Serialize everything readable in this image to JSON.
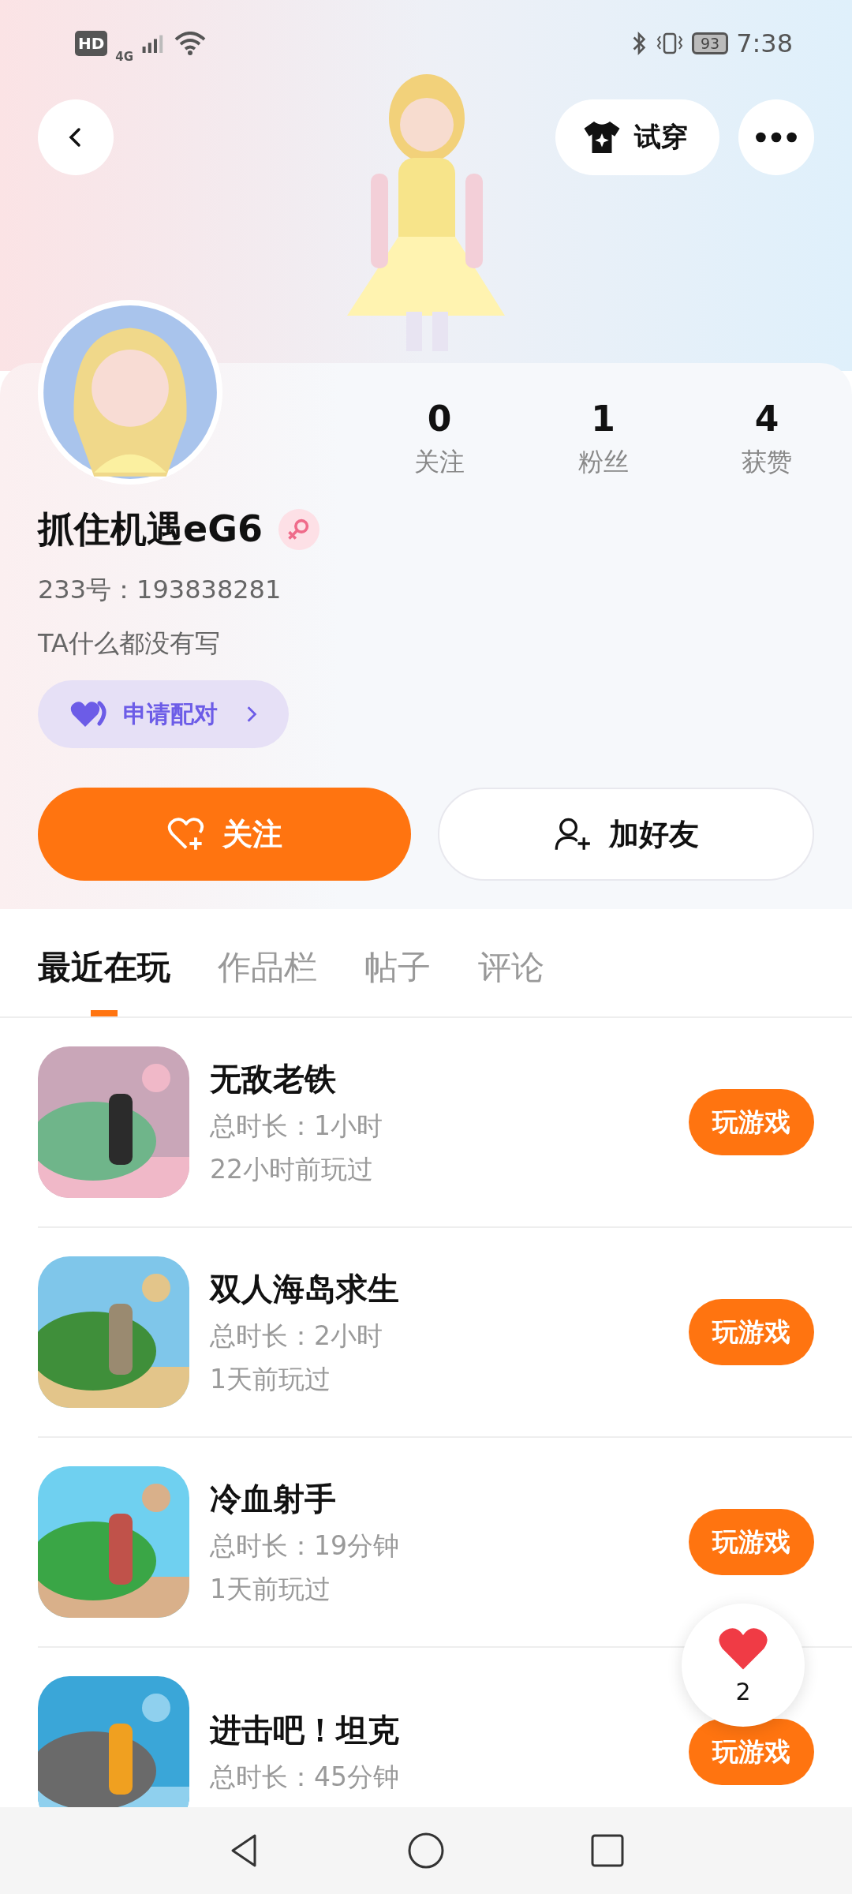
{
  "status_bar": {
    "hd": "HD",
    "network": "4G",
    "battery": "93",
    "time": "7:38"
  },
  "header": {
    "try_on": "试穿"
  },
  "profile": {
    "stats": [
      {
        "value": "0",
        "label": "关注"
      },
      {
        "value": "1",
        "label": "粉丝"
      },
      {
        "value": "4",
        "label": "获赞"
      }
    ],
    "name": "抓住机遇eG6",
    "id_line": "233号：193838281",
    "bio": "TA什么都没有写",
    "match_button": "申请配对"
  },
  "actions": {
    "follow": "关注",
    "add_friend": "加好友"
  },
  "tabs": [
    {
      "label": "最近在玩",
      "selected": true
    },
    {
      "label": "作品栏",
      "selected": false
    },
    {
      "label": "帖子",
      "selected": false
    },
    {
      "label": "评论",
      "selected": false
    }
  ],
  "games": [
    {
      "title": "无敌老铁",
      "duration": "总时长：1小时",
      "last_played": "22小时前玩过",
      "button": "玩游戏",
      "kind": "picture"
    },
    {
      "title": "双人海岛求生",
      "duration": "总时长：2小时",
      "last_played": "1天前玩过",
      "button": "玩游戏",
      "kind": "picture"
    },
    {
      "title": "冷血射手",
      "duration": "总时长：19分钟",
      "last_played": "1天前玩过",
      "button": "玩游戏",
      "kind": "picture"
    },
    {
      "title": "进击吧！坦克",
      "duration": "总时长：45分钟",
      "button": "玩游戏",
      "kind": "picture"
    }
  ],
  "floating_like": {
    "count": "2"
  }
}
